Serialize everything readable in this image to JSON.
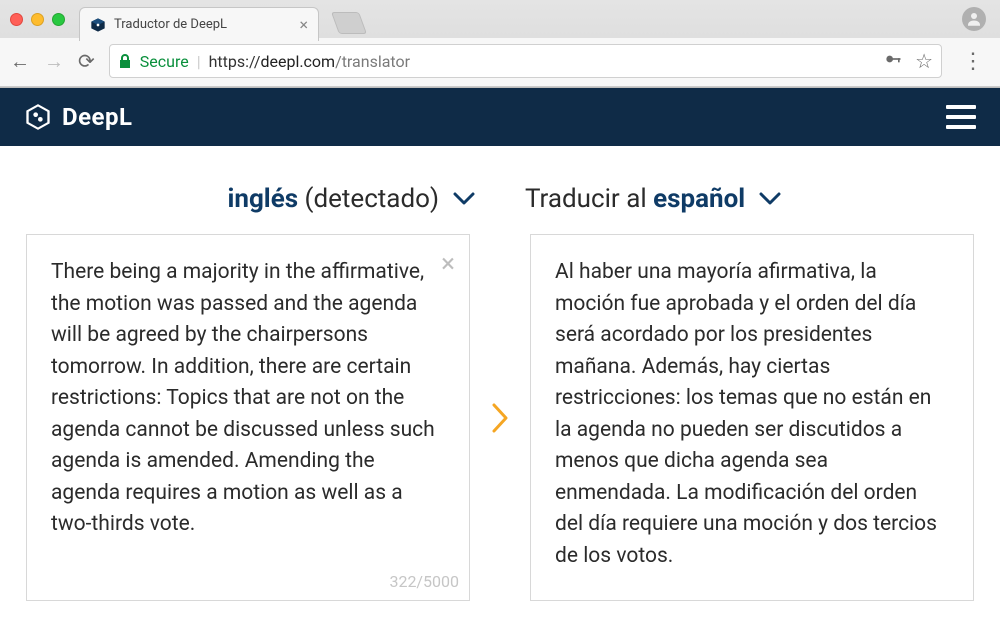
{
  "browser": {
    "tab_title": "Traductor de DeepL",
    "secure_label": "Secure",
    "url_prefix": "https://",
    "url_domain": "deepl.com",
    "url_path": "/translator"
  },
  "app": {
    "brand": "DeepL"
  },
  "language": {
    "source": {
      "strong": "inglés",
      "suffix": "(detectado)"
    },
    "target": {
      "prefix": "Traducir al ",
      "strong": "español"
    }
  },
  "source_text": "There being a majority in the affirmative, the motion was passed and the agenda will be agreed by the chairpersons tomorrow. In addition, there are certain restrictions: Topics that are not on the agenda cannot be discussed unless such agenda is amended. Amending the agenda requires a motion as well as a two-thirds vote.",
  "target_text": "Al haber una mayoría afirmativa, la moción fue aprobada y el orden del día será acordado por los presidentes mañana. Además, hay ciertas restricciones: los temas que no están en la agenda no pueden ser discutidos a menos que dicha agenda sea enmendada. La modificación del orden del día requiere una moción y dos tercios de los votos.",
  "counter": "322/5000",
  "colors": {
    "brand_bg": "#0f2b47",
    "accent": "#f5a623",
    "link": "#0f3b66"
  }
}
